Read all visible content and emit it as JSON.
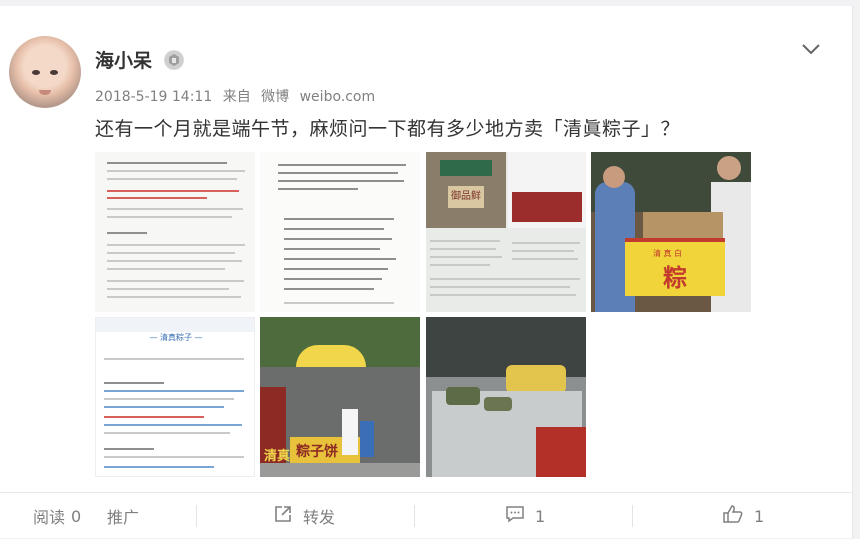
{
  "post": {
    "author": "海小呆",
    "date": "2018-5-19 14:11",
    "source_prefix": "来自",
    "source_app": "微博",
    "source_site": "weibo.com",
    "text": "还有一个月就是端午节，麻烦问一下都有多少地方卖「清眞粽子」？"
  },
  "images": {
    "t4_sign": "粽",
    "t4_sign_top": "清 真 白",
    "t6_sign": "粽子饼",
    "t6_sign2": "清真",
    "t3_sign": "御品鲜",
    "t5_header": "— 清真粽子 —"
  },
  "footer": {
    "read_label": "阅读",
    "read_count": "0",
    "promote_label": "推广",
    "repost_label": "转发",
    "comment_count": "1",
    "like_count": "1"
  },
  "icons": [
    "chevron-down-icon",
    "vip-badge-icon",
    "share-icon",
    "comment-icon",
    "like-icon"
  ]
}
